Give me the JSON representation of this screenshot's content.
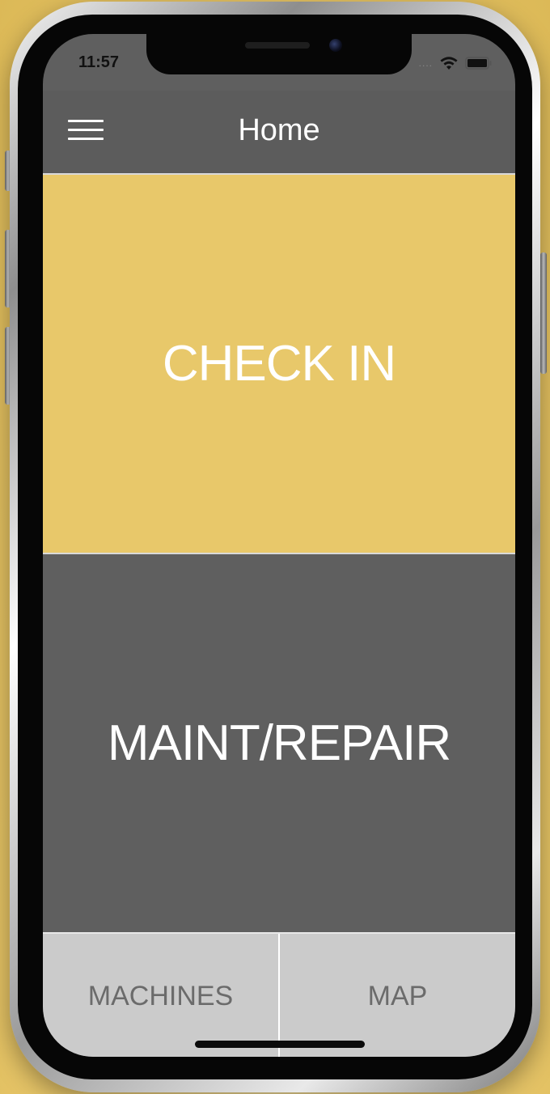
{
  "status": {
    "time": "11:57",
    "signal": "....",
    "wifi_icon": "wifi-icon",
    "battery_icon": "battery-icon"
  },
  "header": {
    "title": "Home",
    "menu_icon": "hamburger-menu-icon"
  },
  "tiles": {
    "checkin_label": "CHECK IN",
    "maint_label": "MAINT/REPAIR"
  },
  "tabs": {
    "machines_label": "MACHINES",
    "map_label": "MAP"
  },
  "colors": {
    "accent_gold": "#e8c86a",
    "header_gray": "#5c5c5c",
    "tile_gray": "#5f5f5f",
    "tab_bar_gray": "#cbcbcb",
    "tab_text": "#6b6b6b"
  }
}
